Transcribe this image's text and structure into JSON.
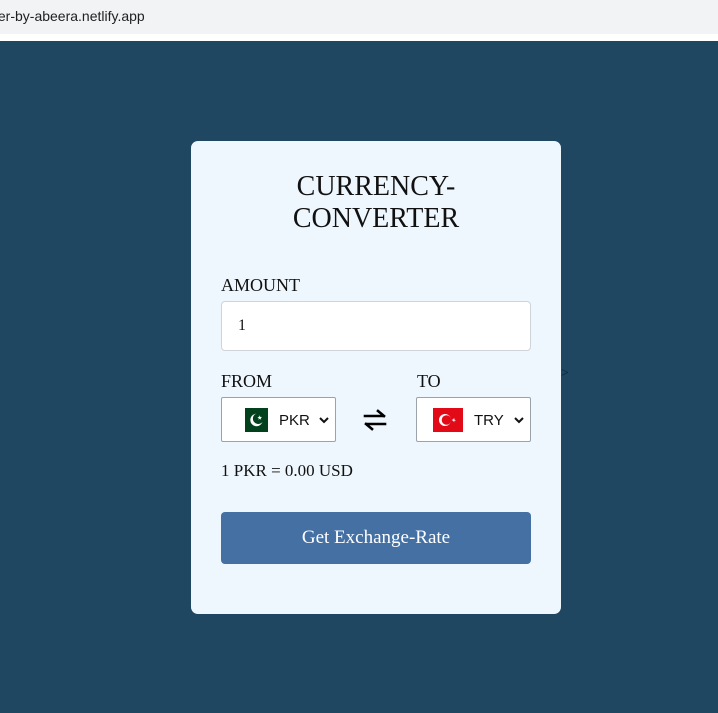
{
  "browser": {
    "url": "ter-by-abeera.netlify.app"
  },
  "stray_text": ">",
  "card": {
    "title_line1": "CURRENCY-",
    "title_line2": "CONVERTER",
    "amount_label": "AMOUNT",
    "amount_value": "1",
    "from_label": "FROM",
    "to_label": "TO",
    "from_currency": "PKR",
    "to_currency": "TRY",
    "from_flag_icon": "pakistan-flag-icon",
    "to_flag_icon": "turkey-flag-icon",
    "swap_icon": "swap-arrows-icon",
    "rate_text": "1 PKR = 0.00 USD",
    "button_label": "Get Exchange-Rate"
  },
  "colors": {
    "background": "#1f4761",
    "card": "#eef7fe",
    "button": "#4470a4"
  }
}
